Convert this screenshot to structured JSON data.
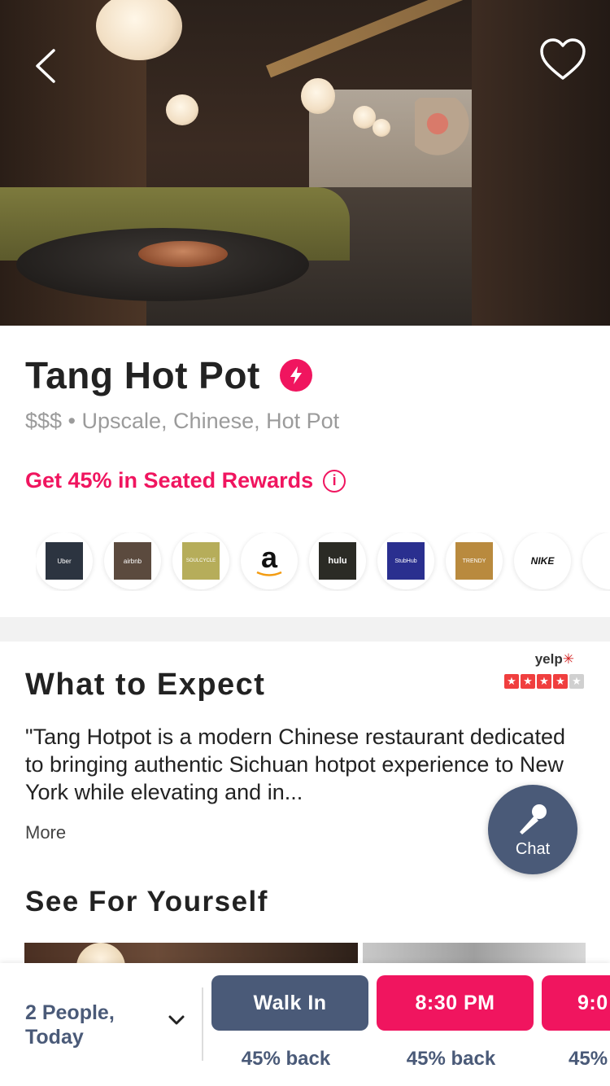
{
  "hero": {
    "back_icon": "chevron-left-icon",
    "favorite_icon": "heart-outline-icon"
  },
  "restaurant": {
    "name": "Tang Hot Pot",
    "badge_icon": "lightning-bolt-icon",
    "details": "$$$ • Upscale, Chinese, Hot Pot",
    "rewards": "Get 45% in Seated Rewards",
    "rewards_info_icon": "info-icon",
    "accent_color": "#f0155f"
  },
  "brands": [
    {
      "name": "Uber"
    },
    {
      "name": "airbnb"
    },
    {
      "name": "SOULCYCLE"
    },
    {
      "name": "a"
    },
    {
      "name": "hulu"
    },
    {
      "name": "StubHub"
    },
    {
      "name": "TRENDY"
    },
    {
      "name": "NIKE"
    }
  ],
  "expect": {
    "heading": "What to Expect",
    "yelp_label": "yelp",
    "rating_stars": 4,
    "rating_max": 5,
    "quote": "\"Tang Hotpot is a modern Chinese restaurant dedicated to bringing authentic Sichuan hotpot experience to New York while elevating and in...",
    "more_label": "More"
  },
  "chat": {
    "label": "Chat",
    "icon": "microphone-icon"
  },
  "see": {
    "heading": "See For Yourself"
  },
  "booking": {
    "party": "2 People, Today",
    "dropdown_icon": "chevron-down-icon",
    "slots": [
      {
        "label": "Walk In",
        "back": "45% back",
        "color": "#4a5a78"
      },
      {
        "label": "8:30 PM",
        "back": "45% back",
        "color": "#f0155f"
      },
      {
        "label": "9:0",
        "back": "45%",
        "color": "#f0155f"
      }
    ]
  }
}
